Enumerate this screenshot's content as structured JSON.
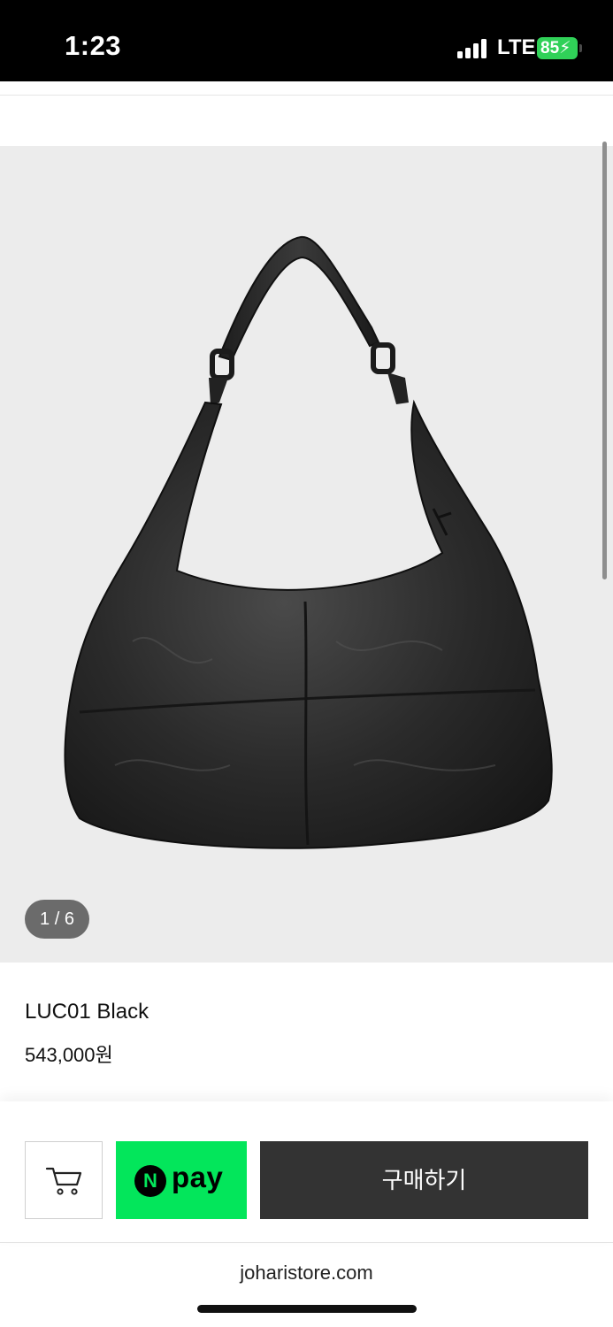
{
  "status_bar": {
    "time": "1:23",
    "network": "LTE",
    "battery": "85"
  },
  "gallery": {
    "counter": "1 / 6",
    "image": "black-leather-hobo-bag"
  },
  "product": {
    "name": "LUC01 Black",
    "price": "543,000원"
  },
  "actions": {
    "cart_icon": "cart-icon",
    "npay_logo_letter": "N",
    "npay_label": "pay",
    "buy_label": "구매하기"
  },
  "browser": {
    "url": "joharistore.com"
  },
  "colors": {
    "npay_green": "#03e65b",
    "buy_button": "#333333",
    "battery_green": "#30d158"
  }
}
